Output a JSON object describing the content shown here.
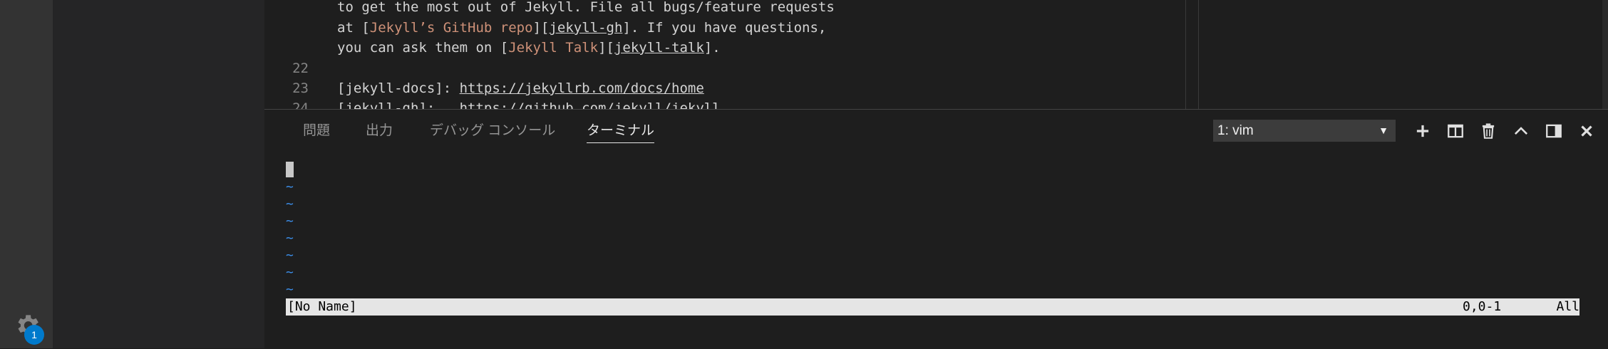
{
  "activity_bar": {
    "settings_badge": "1"
  },
  "editor": {
    "lines": [
      {
        "num": "",
        "segments": [
          {
            "t": "to get the most out of Jekyll. File all bugs/feature requests",
            "c": "plain"
          }
        ]
      },
      {
        "num": "",
        "segments": [
          {
            "t": "at [",
            "c": "plain"
          },
          {
            "t": "Jekyll’s GitHub repo",
            "c": "link"
          },
          {
            "t": "][",
            "c": "plain"
          },
          {
            "t": "jekyll-gh",
            "c": "ref"
          },
          {
            "t": "]. If you have questions,",
            "c": "plain"
          }
        ]
      },
      {
        "num": "",
        "segments": [
          {
            "t": "you can ask them on [",
            "c": "plain"
          },
          {
            "t": "Jekyll Talk",
            "c": "link"
          },
          {
            "t": "][",
            "c": "plain"
          },
          {
            "t": "jekyll-talk",
            "c": "ref"
          },
          {
            "t": "].",
            "c": "plain"
          }
        ]
      },
      {
        "num": "22",
        "segments": []
      },
      {
        "num": "23",
        "segments": [
          {
            "t": "[jekyll-docs]: ",
            "c": "plain"
          },
          {
            "t": "https://jekyllrb.com/docs/home",
            "c": "url"
          }
        ]
      },
      {
        "num": "24",
        "segments": [
          {
            "t": "[jekyll-gh]:   ",
            "c": "plain"
          },
          {
            "t": "https://github.com/jekyll/jekyll",
            "c": "url"
          }
        ]
      }
    ]
  },
  "panel": {
    "tabs": [
      {
        "label": "問題",
        "active": false
      },
      {
        "label": "出力",
        "active": false
      },
      {
        "label": "デバッグ コンソール",
        "active": false
      },
      {
        "label": "ターミナル",
        "active": true
      }
    ],
    "terminal_select": "1: vim",
    "actions": [
      "plus-icon",
      "split-icon",
      "trash-icon",
      "chevron-up-icon",
      "panel-layout-icon",
      "close-icon"
    ]
  },
  "terminal": {
    "tildes": [
      "~",
      "~",
      "~",
      "~",
      "~",
      "~",
      "~"
    ],
    "status_left": "[No Name]",
    "status_pos": "0,0-1",
    "status_right": "All"
  },
  "colors": {
    "accent": "#007acc",
    "link": "#ce9178",
    "tilde": "#3b8eea"
  }
}
